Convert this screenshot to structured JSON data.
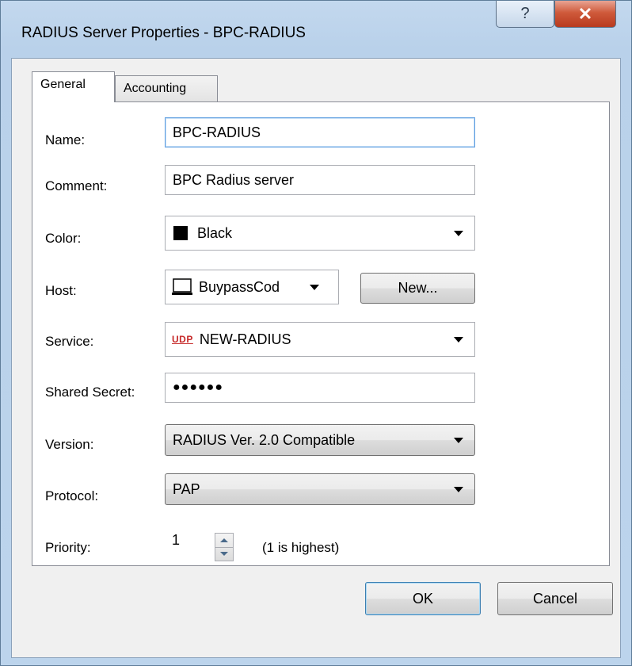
{
  "window": {
    "title": "RADIUS Server Properties - BPC-RADIUS",
    "help_glyph": "?",
    "close_glyph": "✕"
  },
  "tabs": [
    {
      "label": "General",
      "selected": true
    },
    {
      "label": "Accounting",
      "selected": false
    }
  ],
  "form": {
    "name": {
      "label": "Name:",
      "value": "BPC-RADIUS"
    },
    "comment": {
      "label": "Comment:",
      "value": "BPC Radius server"
    },
    "color": {
      "label": "Color:",
      "value": "Black",
      "swatch": "#000000"
    },
    "host": {
      "label": "Host:",
      "value": "BuypassCod ",
      "new_button": "New..."
    },
    "service": {
      "label": "Service:",
      "badge": "UDP",
      "value": "NEW-RADIUS"
    },
    "shared_secret": {
      "label": "Shared Secret:",
      "value": "●●●●●●"
    },
    "version": {
      "label": "Version:",
      "value": "RADIUS Ver. 2.0 Compatible"
    },
    "protocol": {
      "label": "Protocol:",
      "value": "PAP"
    },
    "priority": {
      "label": "Priority:",
      "value": "1",
      "hint": "(1 is highest)"
    }
  },
  "buttons": {
    "ok": "OK",
    "cancel": "Cancel"
  },
  "icons": {
    "host": "computer-icon",
    "service": "udp-protocol-icon"
  }
}
